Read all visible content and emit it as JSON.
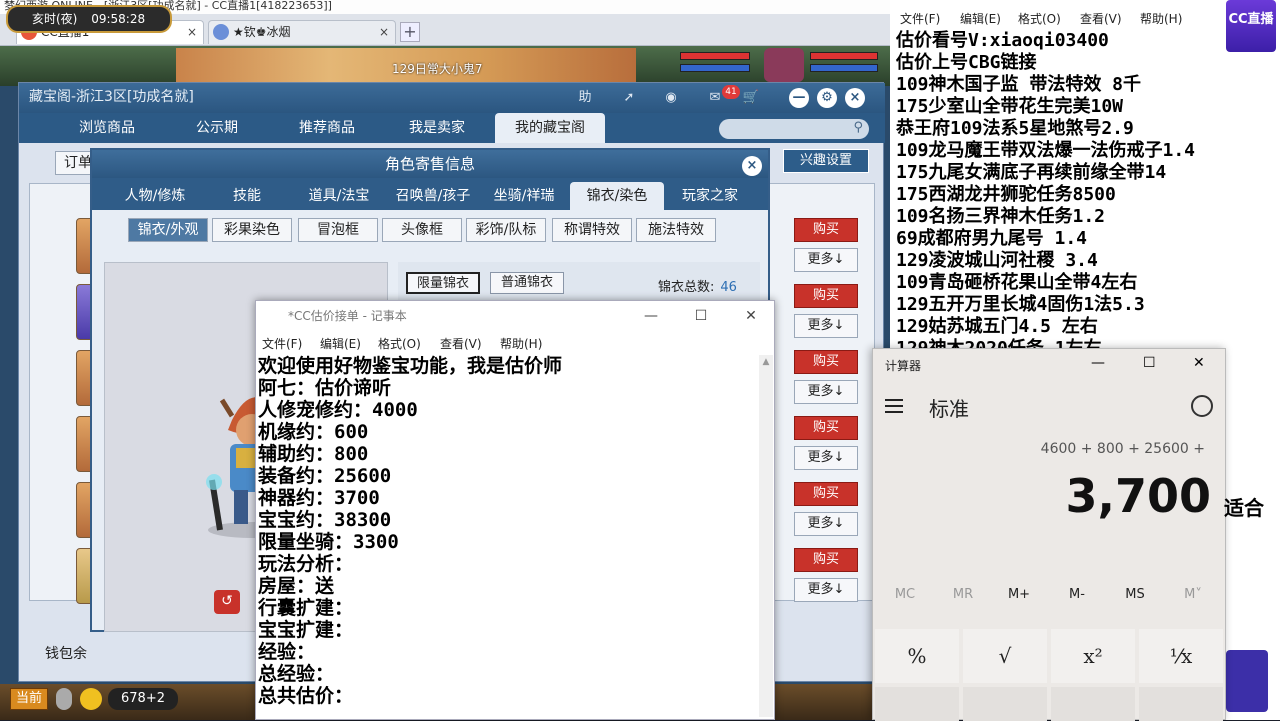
{
  "game_window": {
    "title": "梦幻西游 ONLINE - [浙江3区[功成名就] - CC直播1[418223653]]",
    "tabs": [
      {
        "label": "CC直播1",
        "close": "×"
      },
      {
        "label": "★钦♚冰烟",
        "close": "×"
      }
    ],
    "tab_add": "+",
    "time_period": "亥时(夜)",
    "clock": "09:58:28",
    "scene_label": "129日常大小鬼7",
    "colors": {
      "accent": "#2c5781",
      "buy": "#c8322a"
    }
  },
  "treasure_pavilion": {
    "header": "藏宝阁-浙江3区[功成名就]",
    "header_icons": [
      "help-icon",
      "share-icon",
      "stop-icon",
      "message-icon",
      "cart-icon",
      "minimize-icon",
      "settings-icon",
      "close-icon"
    ],
    "help_label": "助",
    "message_badge": "41",
    "nav": [
      "浏览商品",
      "公示期",
      "推荐商品",
      "我是卖家",
      "我的藏宝阁"
    ],
    "nav_active": "我的藏宝阁",
    "order_label": "订单",
    "interest_label": "兴趣设置",
    "buy_label": "购买",
    "more_label": "更多↓",
    "wallet_label": "钱包余"
  },
  "role_dialog": {
    "title": "角色寄售信息",
    "close": "×",
    "tabs": [
      "人物/修炼",
      "技能",
      "道具/法宝",
      "召唤兽/孩子",
      "坐骑/祥瑞",
      "锦衣/染色",
      "玩家之家"
    ],
    "active_tab": "锦衣/染色",
    "subtabs": [
      "锦衣/外观",
      "彩果染色",
      "冒泡框",
      "头像框",
      "彩饰/队标",
      "称谓特效",
      "施法特效"
    ],
    "active_subtab": "锦衣/外观",
    "skin_buttons": [
      "限量锦衣",
      "普通锦衣"
    ],
    "skin_total_label": "锦衣总数:",
    "skin_total_value": "46",
    "rotate_label": "↺"
  },
  "bottom_bar": {
    "current_label": "当前",
    "coord": "678+2"
  },
  "notepad": {
    "title": "*CC估价接单 - 记事本",
    "menu": [
      "文件(F)",
      "编辑(E)",
      "格式(O)",
      "查看(V)",
      "帮助(H)"
    ],
    "lines": [
      "欢迎使用好物鉴宝功能，我是估价师",
      "阿七：估价谛听",
      "人修宠修约：4000",
      "机缘约：600",
      "辅助约：800",
      "装备约：25600",
      "神器约：3700",
      "宝宝约：38300",
      "限量坐骑：3300",
      "玩法分析：",
      "房屋：送",
      "行囊扩建：",
      "宝宝扩建：",
      "经验：",
      "总经验：",
      "总共估价："
    ]
  },
  "price_list": {
    "menu": [
      "文件(F)",
      "编辑(E)",
      "格式(O)",
      "查看(V)",
      "帮助(H)"
    ],
    "lines": [
      "估价看号V:xiaoqi03400",
      "估价上号CBG链接",
      "109神木国子监 带法特效 8千",
      "175少室山全带花生完美10W",
      "恭王府109法系5星地煞号2.9",
      "109龙马魔王带双法爆一法伤戒子1.4",
      "175九尾女满底子再续前缘全带14",
      "175西湖龙井狮驼任务8500",
      "109名扬三界神木任务1.2",
      "69成都府男九尾号  1.4",
      "129凌波城山河社稷  3.4",
      "109青岛砸桥花果山全带4左右",
      "129五开万里长城4固伤1法5.3",
      "129姑苏城五门4.5 左右",
      "129神木2020任务 1左右"
    ],
    "logo_text": "CC直播"
  },
  "calculator": {
    "title": "计算器",
    "mode": "标准",
    "expression": "4600 + 800 + 25600 +",
    "display": "3,700",
    "memory_keys": [
      "MC",
      "MR",
      "M+",
      "M-",
      "MS",
      "M˅"
    ],
    "keys": [
      "%",
      "√",
      "x²",
      "¹⁄x"
    ],
    "window_controls": [
      "—",
      "☐",
      "✕"
    ],
    "outside_suffix": "适合"
  }
}
